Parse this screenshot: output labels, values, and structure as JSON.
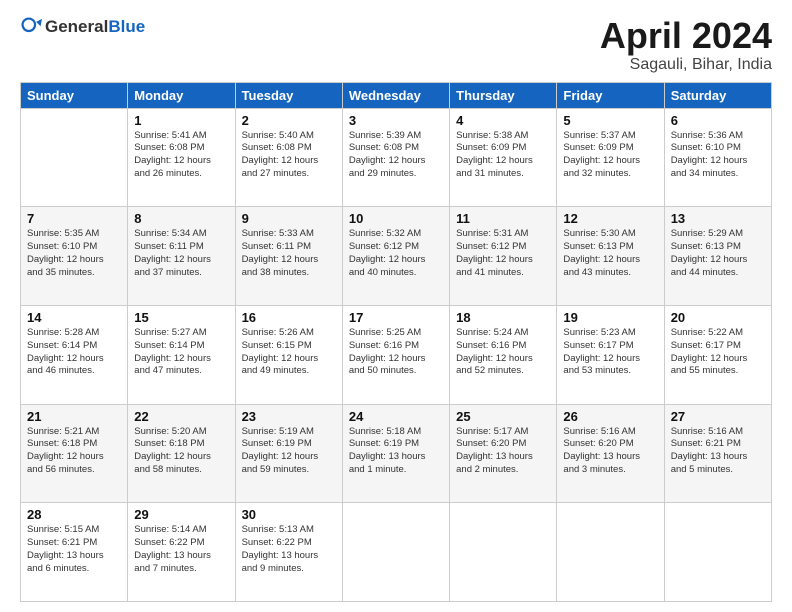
{
  "header": {
    "logo": {
      "part1": "General",
      "part2": "Blue"
    },
    "title": "April 2024",
    "location": "Sagauli, Bihar, India"
  },
  "days_of_week": [
    "Sunday",
    "Monday",
    "Tuesday",
    "Wednesday",
    "Thursday",
    "Friday",
    "Saturday"
  ],
  "weeks": [
    [
      {
        "day": "",
        "content": ""
      },
      {
        "day": "1",
        "content": "Sunrise: 5:41 AM\nSunset: 6:08 PM\nDaylight: 12 hours\nand 26 minutes."
      },
      {
        "day": "2",
        "content": "Sunrise: 5:40 AM\nSunset: 6:08 PM\nDaylight: 12 hours\nand 27 minutes."
      },
      {
        "day": "3",
        "content": "Sunrise: 5:39 AM\nSunset: 6:08 PM\nDaylight: 12 hours\nand 29 minutes."
      },
      {
        "day": "4",
        "content": "Sunrise: 5:38 AM\nSunset: 6:09 PM\nDaylight: 12 hours\nand 31 minutes."
      },
      {
        "day": "5",
        "content": "Sunrise: 5:37 AM\nSunset: 6:09 PM\nDaylight: 12 hours\nand 32 minutes."
      },
      {
        "day": "6",
        "content": "Sunrise: 5:36 AM\nSunset: 6:10 PM\nDaylight: 12 hours\nand 34 minutes."
      }
    ],
    [
      {
        "day": "7",
        "content": "Sunrise: 5:35 AM\nSunset: 6:10 PM\nDaylight: 12 hours\nand 35 minutes."
      },
      {
        "day": "8",
        "content": "Sunrise: 5:34 AM\nSunset: 6:11 PM\nDaylight: 12 hours\nand 37 minutes."
      },
      {
        "day": "9",
        "content": "Sunrise: 5:33 AM\nSunset: 6:11 PM\nDaylight: 12 hours\nand 38 minutes."
      },
      {
        "day": "10",
        "content": "Sunrise: 5:32 AM\nSunset: 6:12 PM\nDaylight: 12 hours\nand 40 minutes."
      },
      {
        "day": "11",
        "content": "Sunrise: 5:31 AM\nSunset: 6:12 PM\nDaylight: 12 hours\nand 41 minutes."
      },
      {
        "day": "12",
        "content": "Sunrise: 5:30 AM\nSunset: 6:13 PM\nDaylight: 12 hours\nand 43 minutes."
      },
      {
        "day": "13",
        "content": "Sunrise: 5:29 AM\nSunset: 6:13 PM\nDaylight: 12 hours\nand 44 minutes."
      }
    ],
    [
      {
        "day": "14",
        "content": "Sunrise: 5:28 AM\nSunset: 6:14 PM\nDaylight: 12 hours\nand 46 minutes."
      },
      {
        "day": "15",
        "content": "Sunrise: 5:27 AM\nSunset: 6:14 PM\nDaylight: 12 hours\nand 47 minutes."
      },
      {
        "day": "16",
        "content": "Sunrise: 5:26 AM\nSunset: 6:15 PM\nDaylight: 12 hours\nand 49 minutes."
      },
      {
        "day": "17",
        "content": "Sunrise: 5:25 AM\nSunset: 6:16 PM\nDaylight: 12 hours\nand 50 minutes."
      },
      {
        "day": "18",
        "content": "Sunrise: 5:24 AM\nSunset: 6:16 PM\nDaylight: 12 hours\nand 52 minutes."
      },
      {
        "day": "19",
        "content": "Sunrise: 5:23 AM\nSunset: 6:17 PM\nDaylight: 12 hours\nand 53 minutes."
      },
      {
        "day": "20",
        "content": "Sunrise: 5:22 AM\nSunset: 6:17 PM\nDaylight: 12 hours\nand 55 minutes."
      }
    ],
    [
      {
        "day": "21",
        "content": "Sunrise: 5:21 AM\nSunset: 6:18 PM\nDaylight: 12 hours\nand 56 minutes."
      },
      {
        "day": "22",
        "content": "Sunrise: 5:20 AM\nSunset: 6:18 PM\nDaylight: 12 hours\nand 58 minutes."
      },
      {
        "day": "23",
        "content": "Sunrise: 5:19 AM\nSunset: 6:19 PM\nDaylight: 12 hours\nand 59 minutes."
      },
      {
        "day": "24",
        "content": "Sunrise: 5:18 AM\nSunset: 6:19 PM\nDaylight: 13 hours\nand 1 minute."
      },
      {
        "day": "25",
        "content": "Sunrise: 5:17 AM\nSunset: 6:20 PM\nDaylight: 13 hours\nand 2 minutes."
      },
      {
        "day": "26",
        "content": "Sunrise: 5:16 AM\nSunset: 6:20 PM\nDaylight: 13 hours\nand 3 minutes."
      },
      {
        "day": "27",
        "content": "Sunrise: 5:16 AM\nSunset: 6:21 PM\nDaylight: 13 hours\nand 5 minutes."
      }
    ],
    [
      {
        "day": "28",
        "content": "Sunrise: 5:15 AM\nSunset: 6:21 PM\nDaylight: 13 hours\nand 6 minutes."
      },
      {
        "day": "29",
        "content": "Sunrise: 5:14 AM\nSunset: 6:22 PM\nDaylight: 13 hours\nand 7 minutes."
      },
      {
        "day": "30",
        "content": "Sunrise: 5:13 AM\nSunset: 6:22 PM\nDaylight: 13 hours\nand 9 minutes."
      },
      {
        "day": "",
        "content": ""
      },
      {
        "day": "",
        "content": ""
      },
      {
        "day": "",
        "content": ""
      },
      {
        "day": "",
        "content": ""
      }
    ]
  ]
}
